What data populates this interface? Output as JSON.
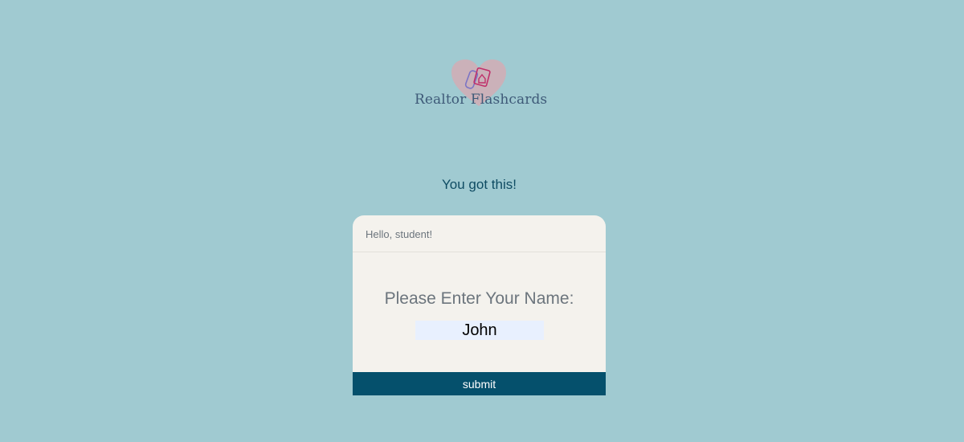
{
  "logo": {
    "text": "Realtor Flashcards",
    "heart_color": "#e8a0a8",
    "icon": "flashcards-heart-icon"
  },
  "tagline": "You got this!",
  "card": {
    "header": "Hello, student!",
    "prompt": "Please Enter Your Name:",
    "name_value": "John",
    "submit_label": "submit"
  },
  "colors": {
    "background": "#a0cad1",
    "accent": "#05506c",
    "card": "#f4f2ed"
  }
}
